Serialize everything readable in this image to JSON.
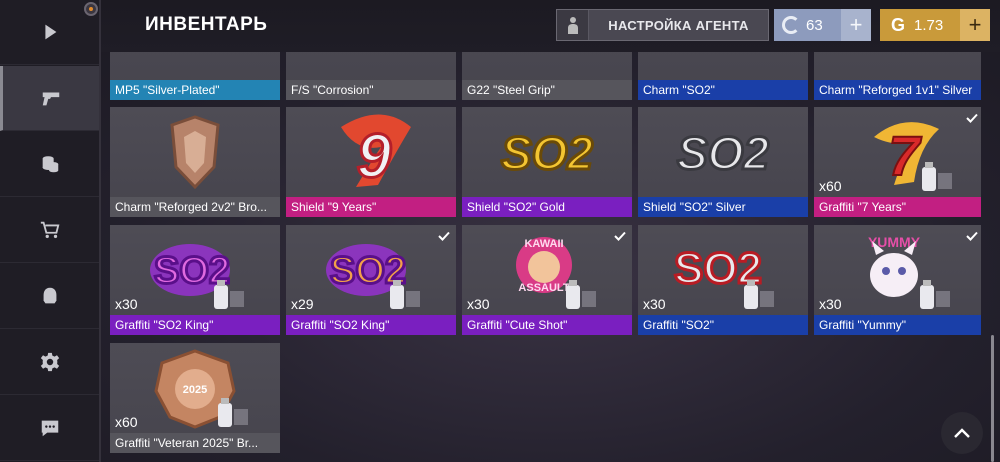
{
  "header": {
    "title": "ИНВЕНТАРЬ",
    "agent_button": "НАСТРОЙКА АГЕНТА",
    "silver_currency": {
      "value": "63",
      "icon": "silver-coin-icon",
      "color": "#8d9bbd"
    },
    "gold_currency": {
      "value": "1.73",
      "icon": "gold-coin-icon",
      "color": "#c99a3a"
    }
  },
  "sidebar": {
    "items": [
      {
        "name": "play-icon",
        "active": false
      },
      {
        "name": "pistol-icon",
        "active": true
      },
      {
        "name": "coins-icon",
        "active": false
      },
      {
        "name": "cart-icon",
        "active": false
      },
      {
        "name": "clan-icon",
        "active": false
      },
      {
        "name": "gear-icon",
        "active": false
      },
      {
        "name": "chat-icon",
        "active": false
      }
    ]
  },
  "items": [
    {
      "caption": "MP5 \"Silver-Plated\"",
      "rarity": "cyan",
      "qty": "",
      "checked": false,
      "art": "weapon"
    },
    {
      "caption": "F/S \"Corrosion\"",
      "rarity": "grey",
      "qty": "",
      "checked": false,
      "art": "weapon"
    },
    {
      "caption": "G22 \"Steel Grip\"",
      "rarity": "grey",
      "qty": "",
      "checked": false,
      "art": "weapon"
    },
    {
      "caption": "Charm \"SO2\"",
      "rarity": "blue",
      "qty": "",
      "checked": false,
      "art": "charm"
    },
    {
      "caption": "Charm \"Reforged 1v1\" Silver",
      "rarity": "blue",
      "qty": "",
      "checked": false,
      "art": "charm"
    },
    {
      "caption": "Charm \"Reforged 2v2\" Bro...",
      "rarity": "grey",
      "qty": "",
      "checked": false,
      "art": "bronze-shield"
    },
    {
      "caption": "Shield \"9 Years\"",
      "rarity": "magenta",
      "qty": "",
      "checked": false,
      "art": "nine"
    },
    {
      "caption": "Shield \"SO2\" Gold",
      "rarity": "purple",
      "qty": "",
      "checked": false,
      "art": "so2-gold"
    },
    {
      "caption": "Shield \"SO2\" Silver",
      "rarity": "blue",
      "qty": "",
      "checked": false,
      "art": "so2-silver"
    },
    {
      "caption": "Graffiti \"7 Years\"",
      "rarity": "magenta",
      "qty": "x60",
      "checked": true,
      "art": "seven"
    },
    {
      "caption": "Graffiti \"SO2 King\"",
      "rarity": "purple",
      "qty": "x30",
      "checked": false,
      "art": "so2-king-purple"
    },
    {
      "caption": "Graffiti \"SO2 King\"",
      "rarity": "purple",
      "qty": "x29",
      "checked": true,
      "art": "so2-king-orange"
    },
    {
      "caption": "Graffiti \"Cute Shot\"",
      "rarity": "purple",
      "qty": "x30",
      "checked": true,
      "art": "cute-shot"
    },
    {
      "caption": "Graffiti \"SO2\"",
      "rarity": "blue",
      "qty": "x30",
      "checked": false,
      "art": "so2-red"
    },
    {
      "caption": "Graffiti \"Yummy\"",
      "rarity": "blue",
      "qty": "x30",
      "checked": true,
      "art": "yummy"
    },
    {
      "caption": "Graffiti \"Veteran 2025\" Br...",
      "rarity": "grey",
      "qty": "x60",
      "checked": false,
      "art": "veteran"
    }
  ],
  "colors": {
    "blue": "#1a3fa8",
    "cyan": "#2384b4",
    "grey": "#56555c",
    "magenta": "#c21f82",
    "purple": "#7a1fc0"
  },
  "art_text": {
    "so2": "SO2",
    "nine": "9",
    "seven": "7",
    "veteran_year": "2025",
    "cute_shot_top": "KAWAII",
    "cute_shot_bottom": "ASSAULT",
    "yummy": "YUMMY"
  }
}
